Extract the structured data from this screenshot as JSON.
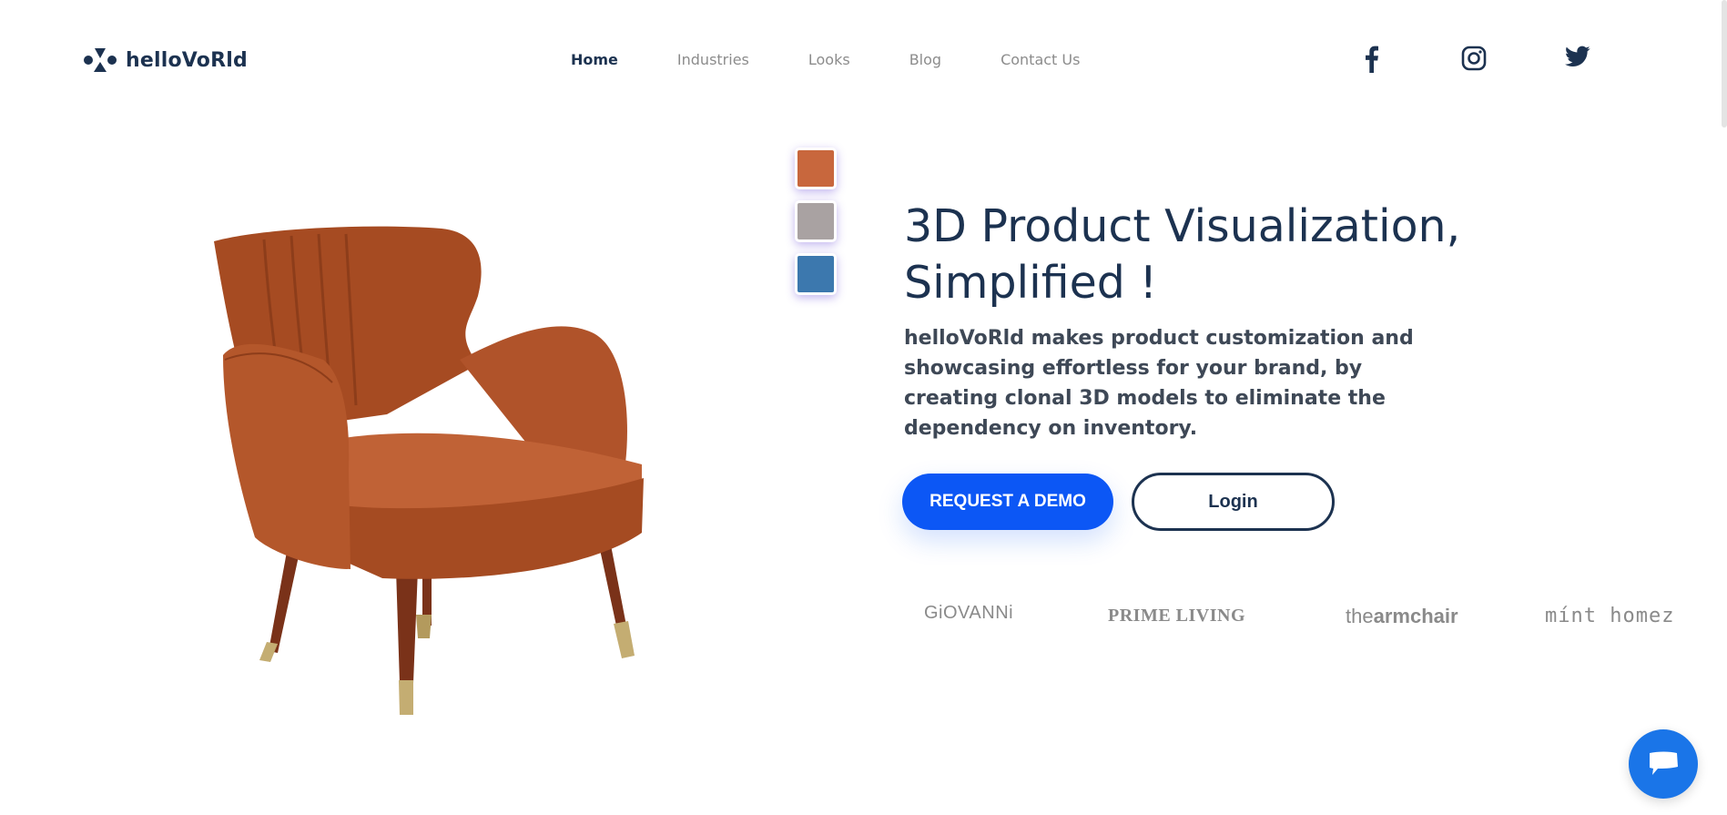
{
  "brand": {
    "name": "helloVoRld",
    "logo_icon": "logo-icon"
  },
  "nav": {
    "items": [
      {
        "label": "Home",
        "active": true
      },
      {
        "label": "Industries",
        "active": false
      },
      {
        "label": "Looks",
        "active": false
      },
      {
        "label": "Blog",
        "active": false
      },
      {
        "label": "Contact Us",
        "active": false
      }
    ]
  },
  "social": [
    {
      "name": "facebook-icon"
    },
    {
      "name": "instagram-icon"
    },
    {
      "name": "twitter-icon"
    }
  ],
  "hero": {
    "title_line1": "3D Product Visualization,",
    "title_line2": "Simplified !",
    "description": "helloVoRld makes product customization and showcasing effortless for your brand, by creating clonal 3D models to eliminate the dependency on inventory.",
    "primary_button": "REQUEST A DEMO",
    "secondary_button": "Login"
  },
  "swatches": [
    {
      "color": "#c8673d"
    },
    {
      "color": "#a9a2a2"
    },
    {
      "color": "#3c78ae"
    }
  ],
  "partners": {
    "giovanni": "GiOVANNi",
    "prime_living": "PRIME LIVING",
    "armchair_prefix": "the",
    "armchair_bold": "armchair",
    "mint_homez": "mínt homez"
  },
  "colors": {
    "primary": "#0c57f5",
    "navy": "#1c3250",
    "chair": "#b5592c",
    "chat": "#1a75e8"
  }
}
